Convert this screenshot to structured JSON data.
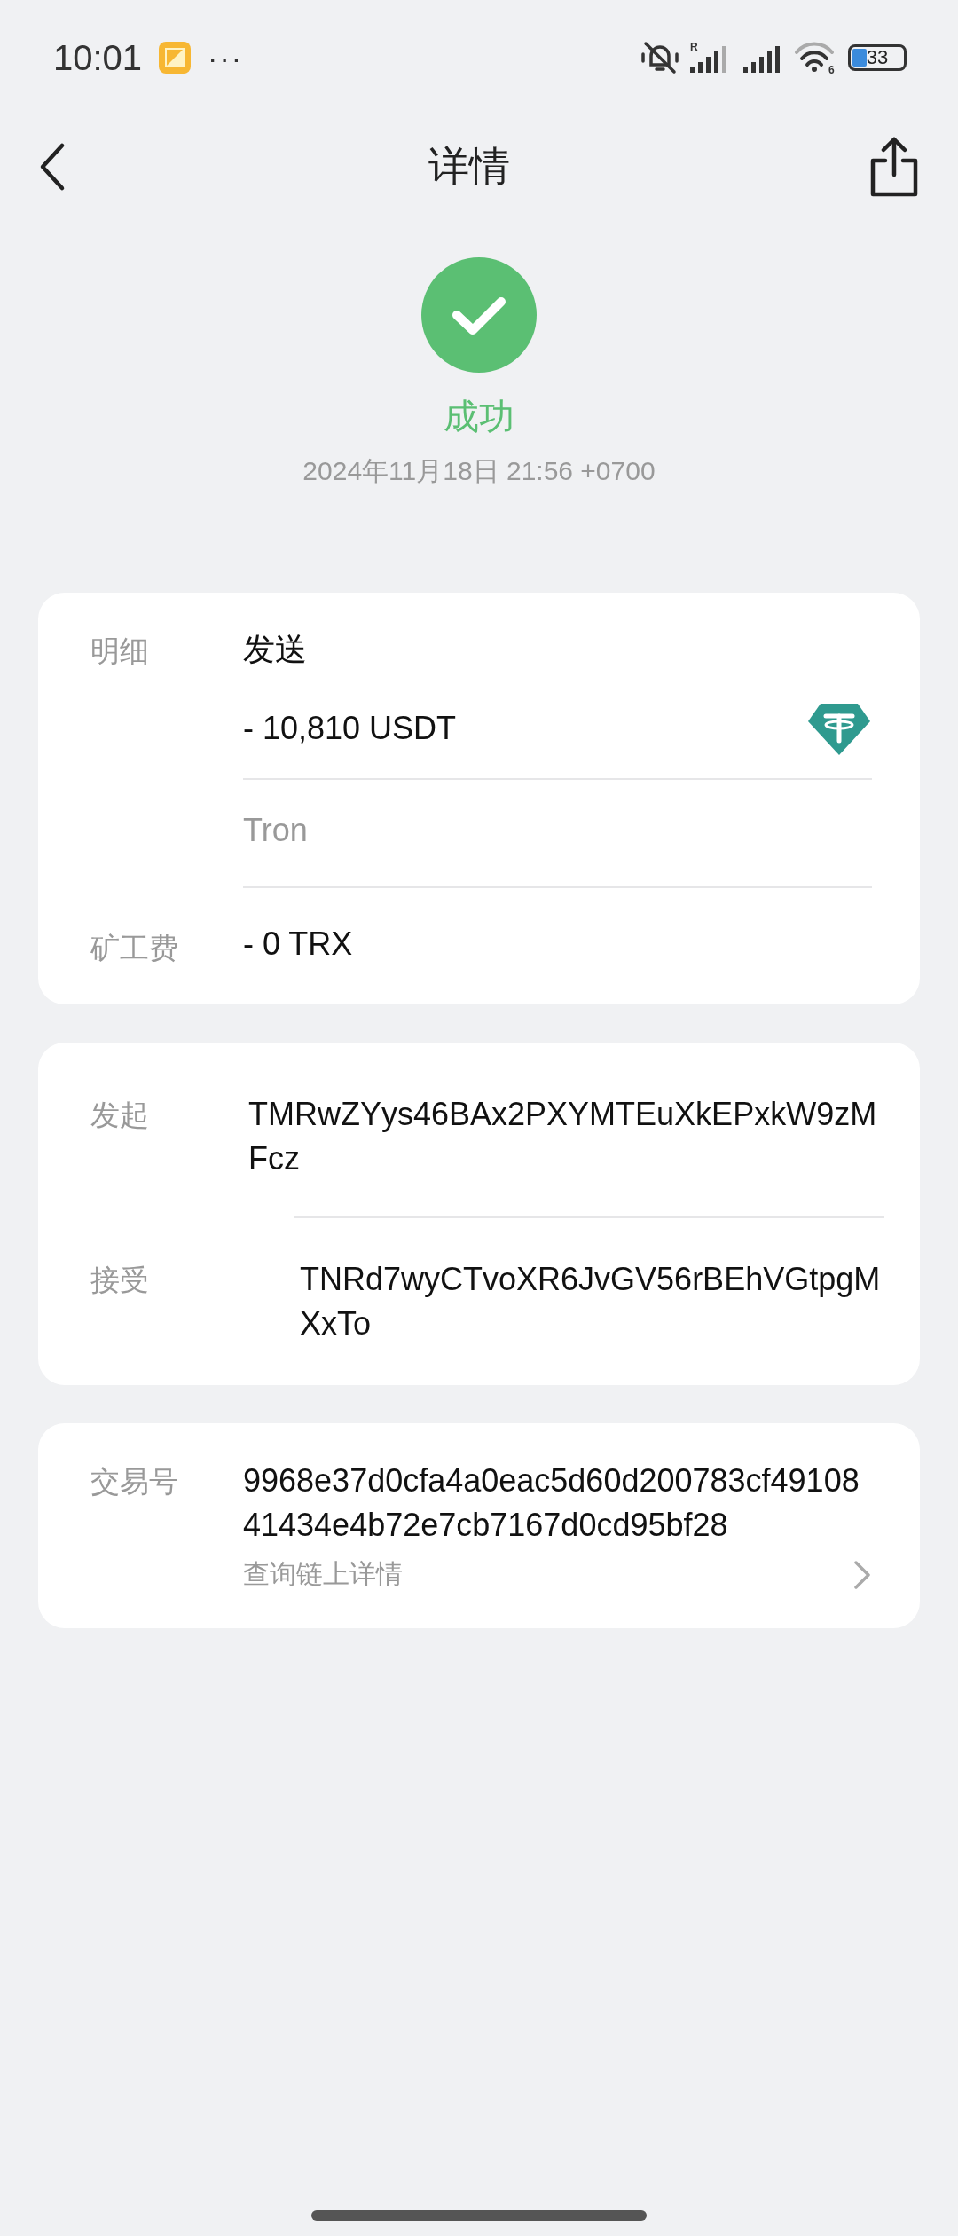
{
  "status_bar": {
    "time": "10:01",
    "more": "···",
    "roaming_mark": "R",
    "wifi_generation": "6",
    "battery": "33"
  },
  "nav": {
    "title": "详情"
  },
  "status": {
    "kind": "success",
    "label": "成功",
    "datetime": "2024年11月18日 21:56 +0700"
  },
  "details_card": {
    "label": "明细",
    "direction": "发送",
    "amount": "- 10,810 USDT",
    "network": "Tron",
    "fee_label": "矿工费",
    "fee": "- 0 TRX"
  },
  "address_card": {
    "rows": [
      {
        "label": "发起",
        "address": "TMRwZYys46BAx2PXYMTEuXkEPxkW9zMFcz"
      },
      {
        "label": "接受",
        "address": "TNRd7wyCTvoXR6JvGV56rBEhVGtpgMXxTo"
      }
    ]
  },
  "tx_card": {
    "label": "交易号",
    "hash": "9968e37d0cfa4a0eac5d60d200783cf4910841434e4b72e7cb7167d0cd95bf28",
    "link": "查询链上详情"
  }
}
